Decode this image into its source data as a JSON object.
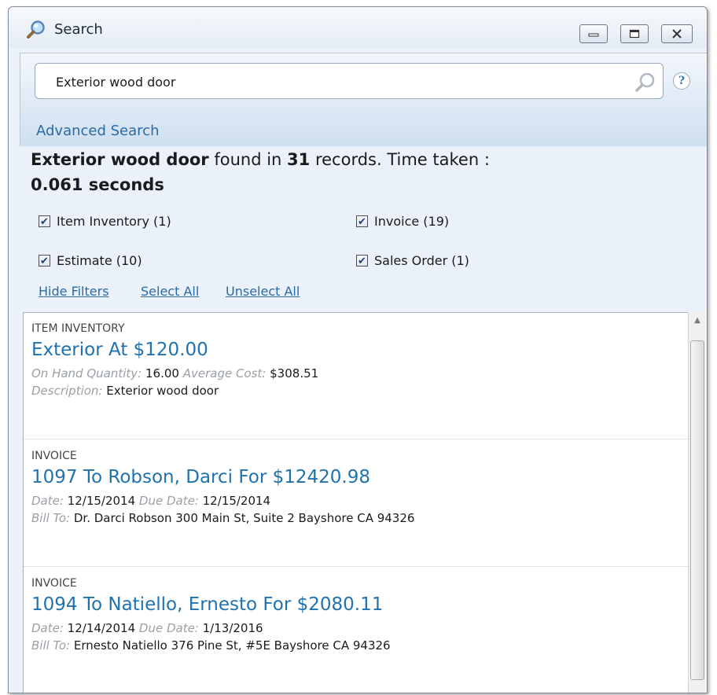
{
  "window": {
    "title": "Search",
    "controls": [
      "minimize-button",
      "maximize-button",
      "close-button"
    ]
  },
  "search": {
    "value": "Exterior wood door",
    "placeholder": "",
    "advanced_label": "Advanced Search"
  },
  "summary": {
    "query": "Exterior wood door",
    "found_in": " found in ",
    "count": "31",
    "tail": " records. Time taken : ",
    "time": "0.061 seconds"
  },
  "filters": [
    {
      "label": "Item Inventory (1)",
      "checked": true
    },
    {
      "label": "Invoice (19)",
      "checked": true
    },
    {
      "label": "Estimate (10)",
      "checked": true
    },
    {
      "label": "Sales Order (1)",
      "checked": true
    }
  ],
  "filter_links": {
    "hide": "Hide Filters",
    "select_all": "Select All",
    "unselect_all": "Unselect All"
  },
  "results": [
    {
      "type": "ITEM INVENTORY",
      "title": "Exterior At $120.00",
      "line1": [
        {
          "label": "On Hand Quantity:",
          "value": " 16.00 "
        },
        {
          "label": "Average Cost:",
          "value": " $308.51"
        }
      ],
      "line2": [
        {
          "label": "Description:",
          "value": " Exterior wood door"
        }
      ]
    },
    {
      "type": "INVOICE",
      "title": "1097 To Robson, Darci For $12420.98",
      "line1": [
        {
          "label": "Date:",
          "value": " 12/15/2014 "
        },
        {
          "label": "Due Date:",
          "value": " 12/15/2014"
        }
      ],
      "line2": [
        {
          "label": "Bill To:",
          "value": " Dr. Darci Robson 300 Main St, Suite 2 Bayshore CA 94326"
        }
      ]
    },
    {
      "type": "INVOICE",
      "title": "1094 To Natiello, Ernesto For $2080.11",
      "line1": [
        {
          "label": "Date:",
          "value": " 12/14/2014 "
        },
        {
          "label": "Due Date:",
          "value": " 1/13/2016"
        }
      ],
      "line2": [
        {
          "label": "Bill To:",
          "value": " Ernesto Natiello 376 Pine St, #5E Bayshore CA 94326"
        }
      ]
    }
  ],
  "colors": {
    "link": "#2a6aa5",
    "result_title": "#1f72b0",
    "field_label": "#9aa0a6"
  }
}
